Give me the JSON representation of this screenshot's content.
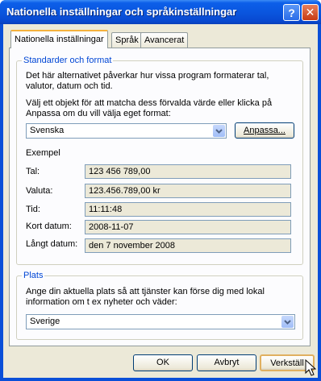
{
  "window": {
    "title": "Nationella inställningar och språkinställningar",
    "help_glyph": "?",
    "close_glyph": "✕"
  },
  "tabs": [
    {
      "label": "Nationella inställningar",
      "active": true
    },
    {
      "label": "Språk",
      "active": false
    },
    {
      "label": "Avancerat",
      "active": false
    }
  ],
  "standards": {
    "legend": "Standarder och format",
    "description": "Det här alternativet påverkar hur vissa program formaterar tal, valutor, datum och tid.",
    "instruction": "Välj ett objekt för att matcha dess förvalda värde eller klicka på Anpassa om du vill välja eget format:",
    "format_selected": "Svenska",
    "customize_label": "Anpassa...",
    "example_heading": "Exempel",
    "examples": [
      {
        "label": "Tal:",
        "value": "123 456 789,00"
      },
      {
        "label": "Valuta:",
        "value": "123.456.789,00 kr"
      },
      {
        "label": "Tid:",
        "value": "11:11:48"
      },
      {
        "label": "Kort datum:",
        "value": "2008-11-07"
      },
      {
        "label": "Långt datum:",
        "value": "den 7 november 2008"
      }
    ]
  },
  "location": {
    "legend": "Plats",
    "description": "Ange din aktuella plats så att tjänster kan förse dig med lokal information om t ex nyheter och väder:",
    "selected": "Sverige"
  },
  "buttons": {
    "ok": "OK",
    "cancel": "Avbryt",
    "apply": "Verkställ"
  },
  "colors": {
    "titlebar": "#0a56df",
    "group_legend": "#0046d5",
    "dialog_bg": "#ece9d8",
    "tab_highlight": "#f5b13c"
  },
  "icons": {
    "help": "help-icon",
    "close": "close-icon",
    "dropdown": "chevron-down-icon",
    "cursor": "mouse-pointer-icon"
  }
}
